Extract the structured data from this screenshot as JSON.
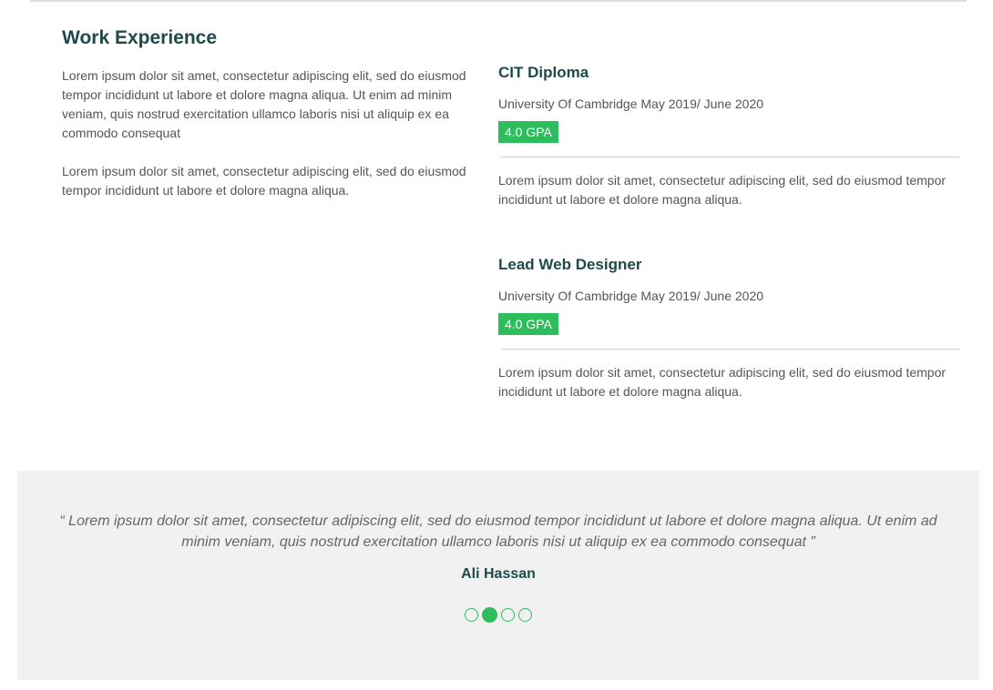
{
  "work_experience": {
    "title": "Work Experience",
    "intro_paragraphs": [
      "Lorem ipsum dolor sit amet, consectetur adipiscing elit, sed do eiusmod tempor incididunt ut labore et dolore magna aliqua. Ut enim ad minim veniam, quis nostrud exercitation ullamco laboris nisi ut aliquip ex ea commodo consequat",
      "Lorem ipsum dolor sit amet, consectetur adipiscing elit, sed do eiusmod tempor incididunt ut labore et dolore magna aliqua."
    ],
    "entries": [
      {
        "title": "CIT Diploma",
        "meta": "University Of Cambridge May 2019/ June 2020",
        "badge": "4.0 GPA",
        "description": "Lorem ipsum dolor sit amet, consectetur adipiscing elit, sed do eiusmod tempor incididunt ut labore et dolore magna aliqua."
      },
      {
        "title": "Lead Web Designer",
        "meta": "University Of Cambridge May 2019/ June 2020",
        "badge": "4.0 GPA",
        "description": "Lorem ipsum dolor sit amet, consectetur adipiscing elit, sed do eiusmod tempor incididunt ut labore et dolore magna aliqua."
      }
    ]
  },
  "testimonial": {
    "quote": "“ Lorem ipsum dolor sit amet, consectetur adipiscing elit, sed do eiusmod tempor incididunt ut labore et dolore magna aliqua. Ut enim ad minim veniam, quis nostrud exercitation ullamco laboris nisi ut aliquip ex ea commodo consequat ”",
    "author": "Ali Hassan",
    "slide_count": 4,
    "active_slide": 2
  },
  "colors": {
    "accent": "#2ebd5c",
    "heading": "#1e4a4a",
    "body_text": "#555555",
    "testimonial_bg": "#f1f1f1"
  }
}
